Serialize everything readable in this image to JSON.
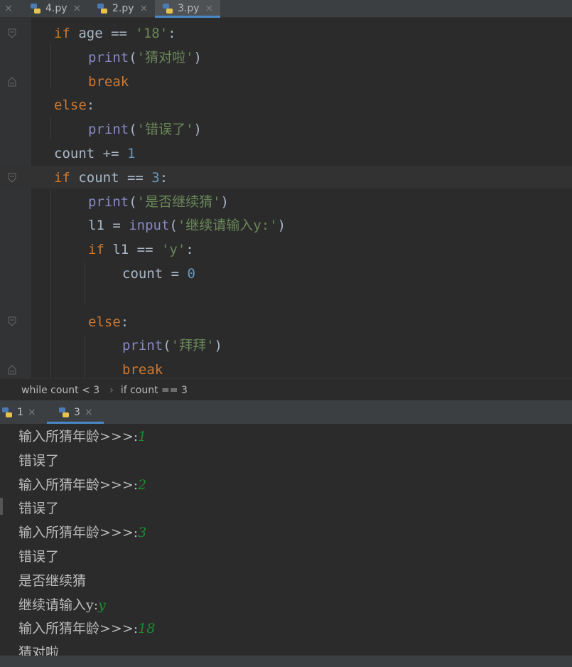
{
  "tabs": [
    {
      "label": "4.py",
      "close": "×",
      "active": false
    },
    {
      "label": "2.py",
      "close": "×",
      "active": false
    },
    {
      "label": "3.py",
      "close": "×",
      "active": true
    }
  ],
  "left_close": "×",
  "code": {
    "lines": [
      {
        "indent": 1,
        "tokens": [
          {
            "t": "if",
            "c": "kw"
          },
          {
            "t": " age == ",
            "c": ""
          },
          {
            "t": "'18'",
            "c": "str"
          },
          {
            "t": ":",
            "c": ""
          }
        ]
      },
      {
        "indent": 2,
        "tokens": [
          {
            "t": "print",
            "c": "fn"
          },
          {
            "t": "(",
            "c": ""
          },
          {
            "t": "'猜对啦'",
            "c": "str"
          },
          {
            "t": ")",
            "c": ""
          }
        ]
      },
      {
        "indent": 2,
        "tokens": [
          {
            "t": "break",
            "c": "kw"
          }
        ]
      },
      {
        "indent": 1,
        "tokens": [
          {
            "t": "else",
            "c": "kw"
          },
          {
            "t": ":",
            "c": ""
          }
        ]
      },
      {
        "indent": 2,
        "tokens": [
          {
            "t": "print",
            "c": "fn"
          },
          {
            "t": "(",
            "c": ""
          },
          {
            "t": "'错误了'",
            "c": "str"
          },
          {
            "t": ")",
            "c": ""
          }
        ]
      },
      {
        "indent": 1,
        "tokens": [
          {
            "t": "count += ",
            "c": ""
          },
          {
            "t": "1",
            "c": "num"
          }
        ]
      },
      {
        "indent": 1,
        "tokens": [
          {
            "t": "if",
            "c": "kw"
          },
          {
            "t": " count == ",
            "c": ""
          },
          {
            "t": "3",
            "c": "num"
          },
          {
            "t": ":",
            "c": ""
          }
        ]
      },
      {
        "indent": 2,
        "tokens": [
          {
            "t": "print",
            "c": "fn"
          },
          {
            "t": "(",
            "c": ""
          },
          {
            "t": "'是否继续猜'",
            "c": "str"
          },
          {
            "t": ")",
            "c": ""
          }
        ]
      },
      {
        "indent": 2,
        "tokens": [
          {
            "t": "l1 = ",
            "c": ""
          },
          {
            "t": "input",
            "c": "fn"
          },
          {
            "t": "(",
            "c": ""
          },
          {
            "t": "'继续请输入y:'",
            "c": "str"
          },
          {
            "t": ")",
            "c": ""
          }
        ]
      },
      {
        "indent": 2,
        "tokens": [
          {
            "t": "if",
            "c": "kw"
          },
          {
            "t": " l1 == ",
            "c": ""
          },
          {
            "t": "'y'",
            "c": "str"
          },
          {
            "t": ":",
            "c": ""
          }
        ]
      },
      {
        "indent": 3,
        "tokens": [
          {
            "t": "count = ",
            "c": ""
          },
          {
            "t": "0",
            "c": "num"
          }
        ]
      },
      {
        "indent": 0,
        "tokens": []
      },
      {
        "indent": 2,
        "tokens": [
          {
            "t": "else",
            "c": "kw"
          },
          {
            "t": ":",
            "c": ""
          }
        ]
      },
      {
        "indent": 3,
        "tokens": [
          {
            "t": "print",
            "c": "fn"
          },
          {
            "t": "(",
            "c": ""
          },
          {
            "t": "'拜拜'",
            "c": "str"
          },
          {
            "t": ")",
            "c": ""
          }
        ]
      },
      {
        "indent": 3,
        "tokens": [
          {
            "t": "break",
            "c": "kw"
          }
        ]
      }
    ]
  },
  "breadcrumb": {
    "item1": "while count < 3",
    "separator": "›",
    "item2": "if count == 3"
  },
  "run_tabs": [
    {
      "label": "1",
      "close": "×",
      "active": false
    },
    {
      "label": "3",
      "close": "×",
      "active": true
    }
  ],
  "console": {
    "lines": [
      {
        "text": "输入所猜年龄>>>:",
        "input": "1"
      },
      {
        "text": "错误了",
        "input": ""
      },
      {
        "text": "输入所猜年龄>>>:",
        "input": "2"
      },
      {
        "text": "错误了",
        "input": ""
      },
      {
        "text": "输入所猜年龄>>>:",
        "input": "3"
      },
      {
        "text": "错误了",
        "input": ""
      },
      {
        "text": "是否继续猜",
        "input": ""
      },
      {
        "text": "继续请输入y:",
        "input": "y"
      },
      {
        "text": "输入所猜年龄>>>:",
        "input": "18"
      },
      {
        "text": "猜对啦",
        "input": ""
      }
    ]
  },
  "colors": {
    "keyword": "#cc7832",
    "builtin": "#8888c6",
    "string": "#6a8759",
    "number": "#6897bb",
    "user_input": "#1e8a32",
    "accent": "#4a88c7"
  },
  "icons": [
    "python-file-icon",
    "close-icon",
    "chevron-right-icon",
    "fold-marker-icon"
  ]
}
